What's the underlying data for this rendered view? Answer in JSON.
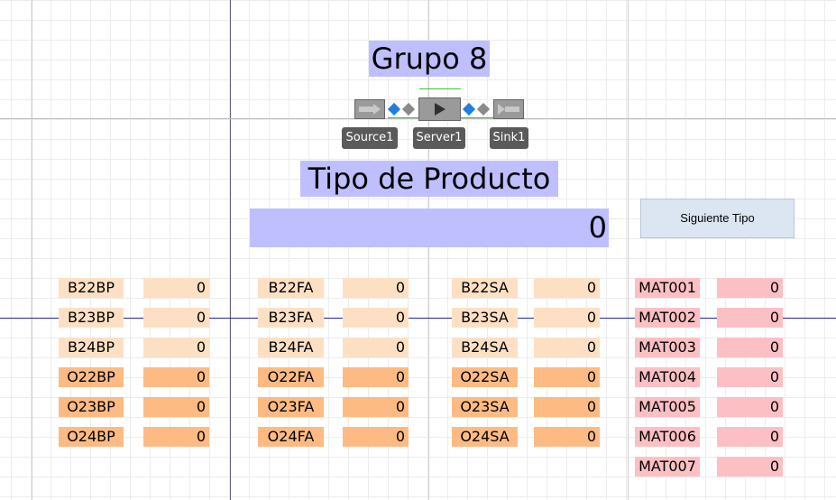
{
  "group_title": "Grupo 8",
  "model": {
    "source_label": "Source1",
    "server_label": "Server1",
    "sink_label": "Sink1"
  },
  "product_type": {
    "title": "Tipo de Producto",
    "value": "0"
  },
  "next_button_label": "Siguiente Tipo",
  "col_bp": {
    "labels": [
      "B22BP",
      "B23BP",
      "B24BP",
      "O22BP",
      "O23BP",
      "O24BP"
    ],
    "values": [
      "0",
      "0",
      "0",
      "0",
      "0",
      "0"
    ]
  },
  "col_fa": {
    "labels": [
      "B22FA",
      "B23FA",
      "B24FA",
      "O22FA",
      "O23FA",
      "O24FA"
    ],
    "values": [
      "0",
      "0",
      "0",
      "0",
      "0",
      "0"
    ]
  },
  "col_sa": {
    "labels": [
      "B22SA",
      "B23SA",
      "B24SA",
      "O22SA",
      "O23SA",
      "O24SA"
    ],
    "values": [
      "0",
      "0",
      "0",
      "0",
      "0",
      "0"
    ]
  },
  "col_mat": {
    "labels": [
      "MAT001",
      "MAT002",
      "MAT003",
      "MAT004",
      "MAT005",
      "MAT006",
      "MAT007"
    ],
    "values": [
      "0",
      "0",
      "0",
      "0",
      "0",
      "0",
      "0"
    ]
  },
  "colors": {
    "light_orange": "#fde0c4",
    "orange": "#fdbb83",
    "pink": "#fcc0c4",
    "title_bg": "#bfbfff",
    "button_bg": "#dce6f2"
  }
}
